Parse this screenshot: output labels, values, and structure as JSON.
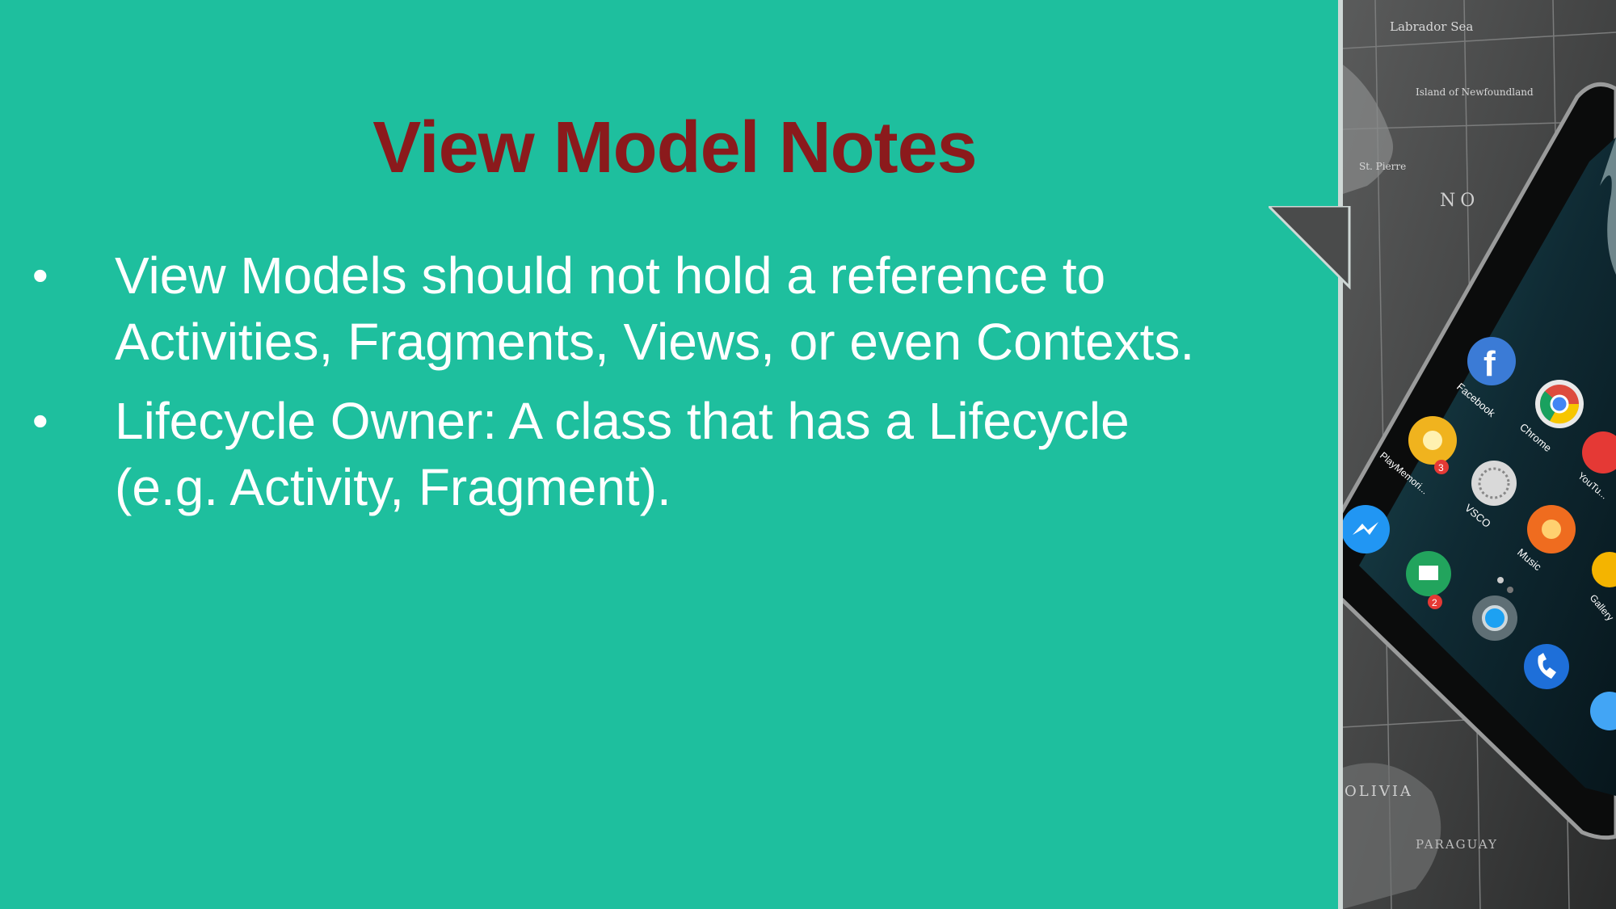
{
  "slide": {
    "title": "View Model Notes",
    "bullets": [
      "View Models should not hold a reference to Activities, Fragments, Views, or even Contexts.",
      "Lifecycle Owner: A class that has a Lifecycle (e.g. Activity, Fragment)."
    ],
    "bullet_symbol": "•"
  },
  "colors": {
    "background": "#1ebf9e",
    "title": "#8b1a1c",
    "body_text": "#ffffff"
  },
  "decorative_image": {
    "map_labels": [
      "Labrador Sea",
      "Island of Newfoundland",
      "St. Pierre",
      "NO",
      "OLIVIA",
      "PARAGUAY"
    ],
    "app_labels": [
      "Facebook",
      "Chrome",
      "PlayMemori...",
      "VSCO",
      "YouTu...",
      "Music",
      "Gallery"
    ],
    "badges": [
      "3",
      "2"
    ]
  }
}
